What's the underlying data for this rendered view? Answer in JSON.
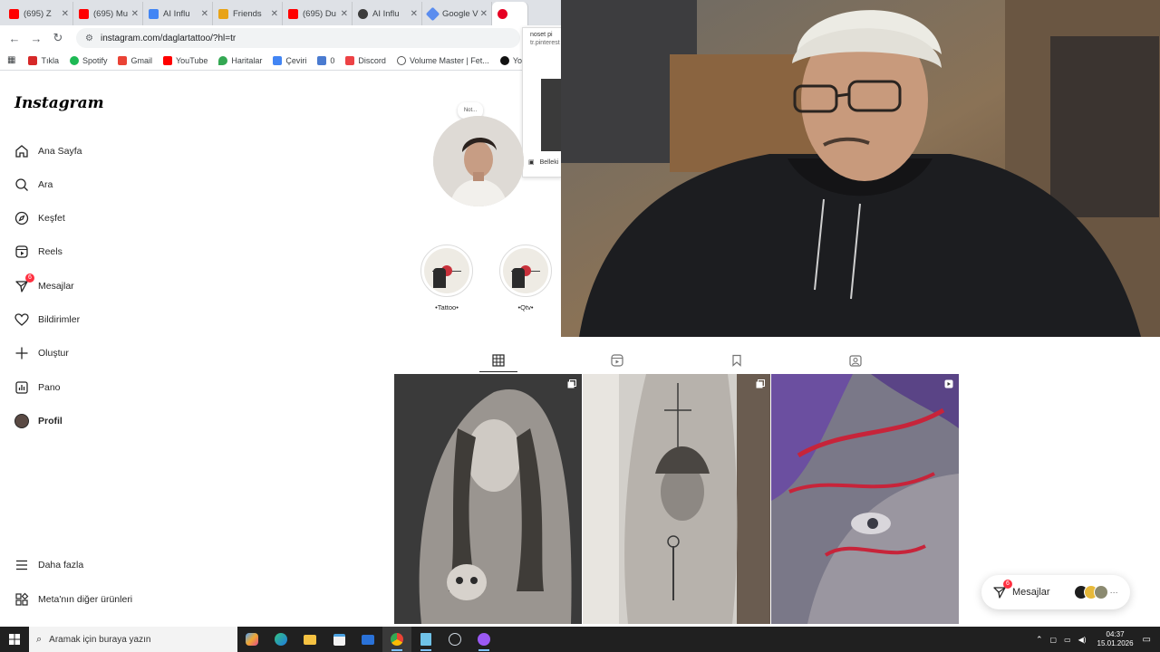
{
  "browser": {
    "tabs": [
      {
        "title": "(695) Z"
      },
      {
        "title": "(695) Mu"
      },
      {
        "title": "AI Influ"
      },
      {
        "title": "Friends"
      },
      {
        "title": "(695) Du"
      },
      {
        "title": "AI Influ"
      },
      {
        "title": "Google V"
      },
      {
        "title": ""
      }
    ],
    "url": "instagram.com/daglartattoo/?hl=tr",
    "bookmarks": [
      "Tıkla",
      "Spotify",
      "Gmail",
      "YouTube",
      "Haritalar",
      "Çeviri",
      "0",
      "Discord",
      "Volume Master | Fet...",
      "Your"
    ]
  },
  "popup": {
    "line1": "noset pi",
    "line2": "tr.pinterest",
    "save_label": "Belleki"
  },
  "instagram": {
    "logo": "Instagram",
    "nav": {
      "home": "Ana Sayfa",
      "search": "Ara",
      "explore": "Keşfet",
      "reels": "Reels",
      "messages": "Mesajlar",
      "messages_badge": "6",
      "notifications": "Bildirimler",
      "create": "Oluştur",
      "dashboard": "Pano",
      "profile": "Profil",
      "more": "Daha fazla",
      "meta": "Meta'nın diğer ürünleri"
    },
    "profile": {
      "note": "Not...",
      "highlights": [
        {
          "label": "•Tattoo•"
        },
        {
          "label": "•Qtv•"
        }
      ]
    },
    "messages_pill": {
      "label": "Mesajlar",
      "badge": "6",
      "more": "···"
    }
  },
  "taskbar": {
    "search_placeholder": "Aramak için buraya yazın",
    "time": "04:37",
    "date": "15.01.2026"
  }
}
